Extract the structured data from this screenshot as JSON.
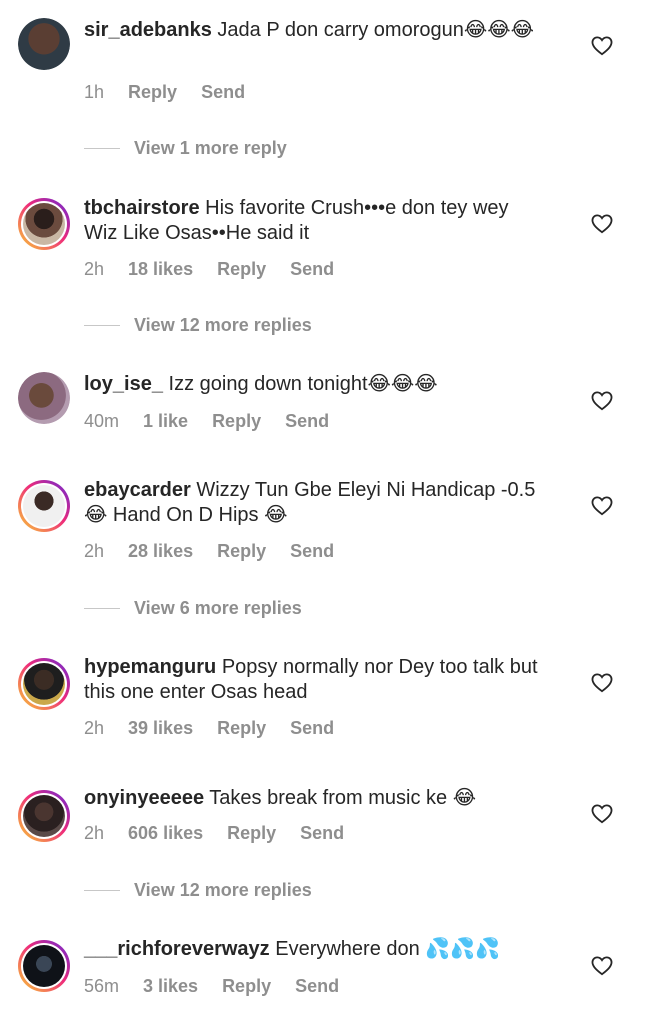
{
  "comments": [
    {
      "username": "sir_adebanks",
      "text": "Jada P don carry omorogun😂😂😂",
      "time": "1h",
      "likes": "",
      "reply": "Reply",
      "send": "Send",
      "view_replies": "View 1 more reply"
    },
    {
      "username": "tbchairstore",
      "text": "His favorite Crush•••e don tey wey Wiz Like Osas••He said it",
      "time": "2h",
      "likes": "18 likes",
      "reply": "Reply",
      "send": "Send",
      "view_replies": "View 12 more replies"
    },
    {
      "username": "loy_ise_",
      "text": "Izz going down tonight😂😂😂",
      "time": "40m",
      "likes": "1 like",
      "reply": "Reply",
      "send": "Send",
      "view_replies": ""
    },
    {
      "username": "ebaycarder",
      "text": "Wizzy Tun Gbe Eleyi Ni Handicap -0.5 😂 Hand On D Hips 😂",
      "time": "2h",
      "likes": "28 likes",
      "reply": "Reply",
      "send": "Send",
      "view_replies": "View 6 more replies"
    },
    {
      "username": "hypemanguru",
      "text": "Popsy normally nor Dey too talk but this one enter Osas head",
      "time": "2h",
      "likes": "39 likes",
      "reply": "Reply",
      "send": "Send",
      "view_replies": ""
    },
    {
      "username": "onyinyeeeee",
      "text": "Takes break from music ke 😂",
      "time": "2h",
      "likes": "606 likes",
      "reply": "Reply",
      "send": "Send",
      "view_replies": "View 12 more replies"
    },
    {
      "username": "___richforeverwayz",
      "text": "Everywhere don 💦💦💦",
      "time": "56m",
      "likes": "3 likes",
      "reply": "Reply",
      "send": "Send",
      "view_replies": ""
    }
  ]
}
